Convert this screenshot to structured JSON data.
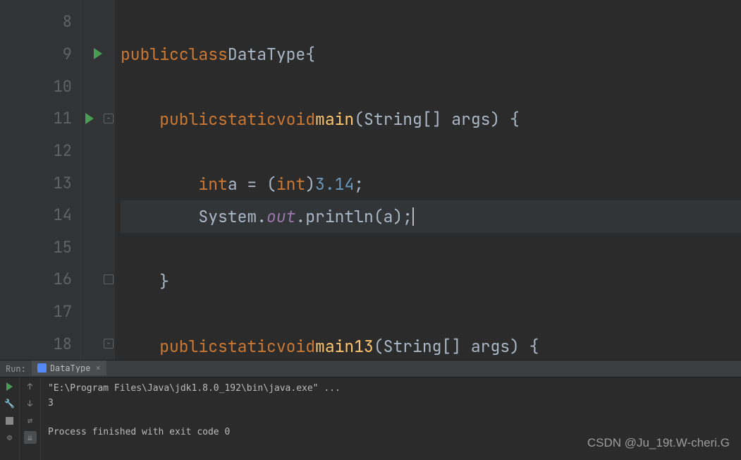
{
  "gutter": {
    "lines": [
      "8",
      "9",
      "10",
      "11",
      "12",
      "13",
      "14",
      "15",
      "16",
      "17",
      "18"
    ],
    "run_markers": [
      9,
      11
    ],
    "fold_markers": [
      11,
      16,
      18
    ]
  },
  "code": {
    "l9": {
      "kw1": "public",
      "kw2": "class",
      "cls": "DataType",
      "brace": "{"
    },
    "l11": {
      "ind": "    ",
      "kw1": "public",
      "kw2": "static",
      "kw3": "void",
      "mth": "main",
      "params": "(String[] args) {"
    },
    "l13": {
      "ind": "        ",
      "kw1": "int",
      "var": "a = (",
      "kw2": "int",
      "paren": ")",
      "num": "3.14",
      "semi": ";"
    },
    "l14": {
      "ind": "        ",
      "sys": "System.",
      "out": "out",
      "dot": ".println(a);"
    },
    "l16": {
      "ind": "    ",
      "brace": "}"
    },
    "l18": {
      "ind": "    ",
      "kw1": "public",
      "kw2": "static",
      "kw3": "void",
      "mth": "main13",
      "params": "(String[] args) {"
    }
  },
  "run": {
    "label": "Run:",
    "tab_name": "DataType",
    "output_cmd": "\"E:\\Program Files\\Java\\jdk1.8.0_192\\bin\\java.exe\" ...",
    "output_val": "3",
    "output_exit": "Process finished with exit code 0"
  },
  "watermark": "CSDN @Ju_19t.W-cheri.G"
}
